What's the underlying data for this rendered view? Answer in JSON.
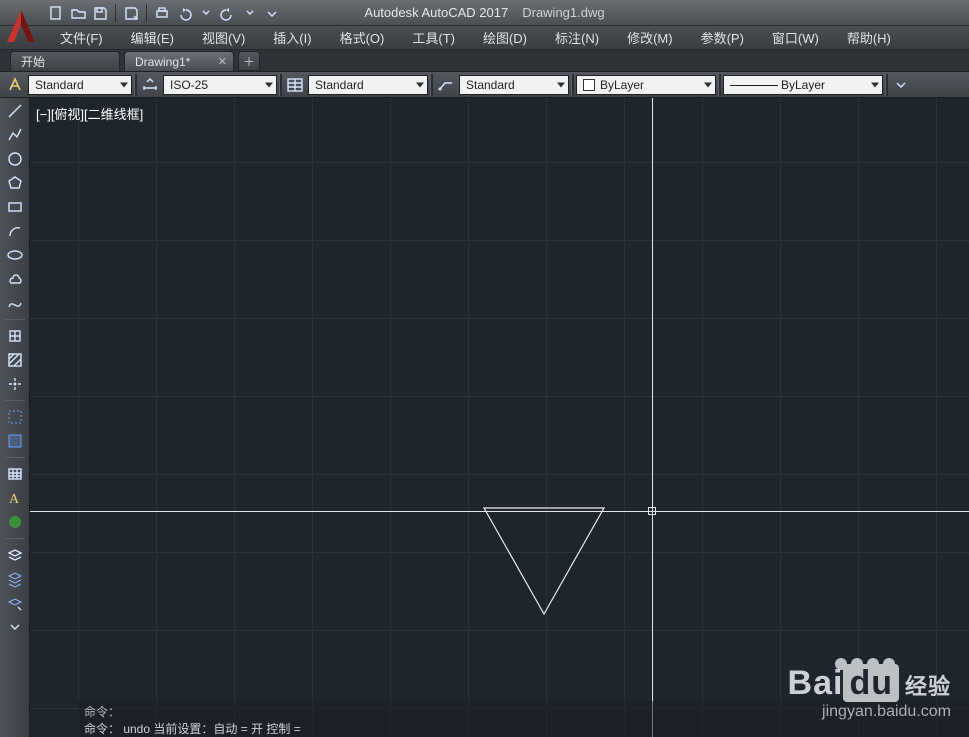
{
  "title": {
    "app": "Autodesk AutoCAD 2017",
    "file": "Drawing1.dwg"
  },
  "menu": {
    "file": "文件(F)",
    "edit": "编辑(E)",
    "view": "视图(V)",
    "insert": "插入(I)",
    "format": "格式(O)",
    "tools": "工具(T)",
    "draw": "绘图(D)",
    "dim": "标注(N)",
    "modify": "修改(M)",
    "param": "参数(P)",
    "window": "窗口(W)",
    "help": "帮助(H)"
  },
  "tabs": {
    "start": "开始",
    "doc": "Drawing1*"
  },
  "styles": {
    "text": "Standard",
    "dim": "ISO-25",
    "table": "Standard",
    "mleader": "Standard",
    "color": "ByLayer",
    "lweight": "ByLayer"
  },
  "viewport": {
    "label": "[−][俯视][二维线框]"
  },
  "command": {
    "row1": "命令：",
    "row2": "命令：  undo  当前设置：自动 = 开  控制 ="
  },
  "watermark": {
    "brand_left": "Bai",
    "brand_box": "du",
    "brand_cn": "经验",
    "url": "jingyan.baidu.com"
  }
}
